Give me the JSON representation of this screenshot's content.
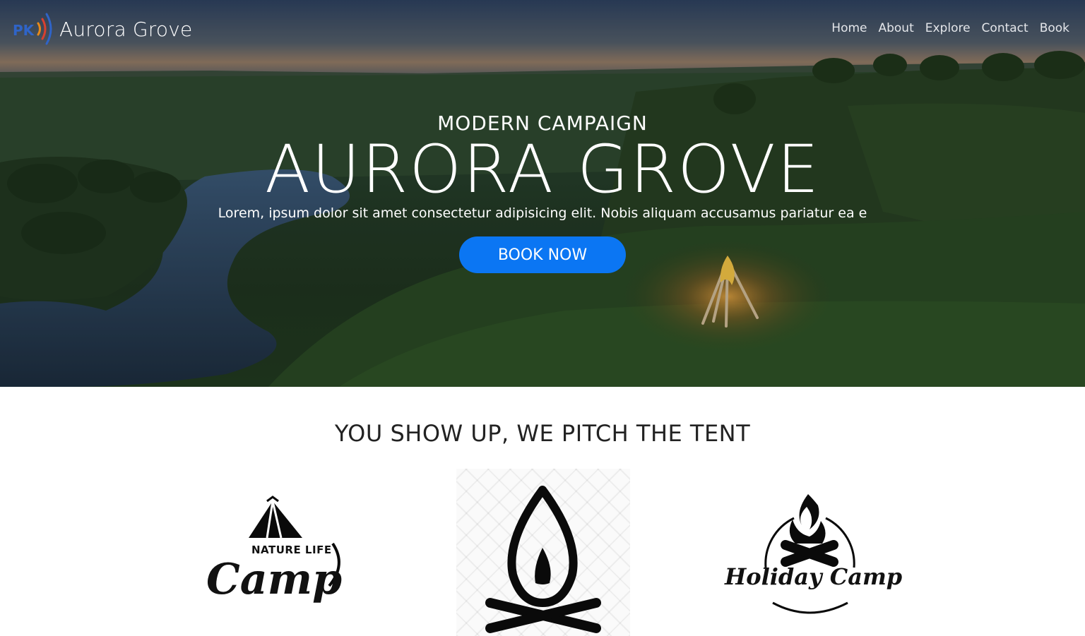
{
  "brand": {
    "logo_text": "PK",
    "name": "Aurora Grove"
  },
  "nav": {
    "items": [
      "Home",
      "About",
      "Explore",
      "Contact",
      "Book"
    ]
  },
  "hero": {
    "subtitle": "MODERN CAMPAIGN",
    "title": "AURORA GROVE",
    "text": "Lorem, ipsum dolor sit amet consectetur adipisicing elit. Nobis aliquam accusamus pariatur ea e",
    "button_label": "BOOK NOW"
  },
  "section": {
    "title": "YOU SHOW UP, WE PITCH THE TENT",
    "features": [
      {
        "small": "NATURE LIFE",
        "big": "Camp"
      },
      {
        "icon": "campfire-icon"
      },
      {
        "big": "Holiday Camp"
      }
    ]
  },
  "colors": {
    "accent": "#0b76f3",
    "logo": "#2f64c8"
  }
}
